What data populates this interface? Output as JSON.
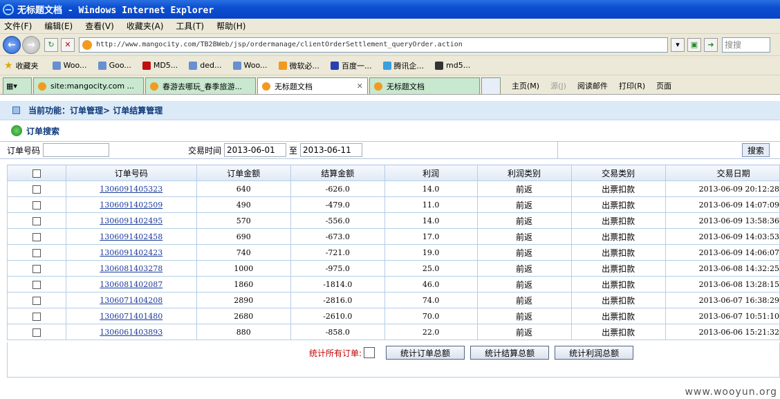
{
  "window": {
    "title": "无标题文档 - Windows Internet Explorer"
  },
  "menu": [
    "文件(F)",
    "编辑(E)",
    "查看(V)",
    "收藏夹(A)",
    "工具(T)",
    "帮助(H)"
  ],
  "address": {
    "url": "http://www.mangocity.com/TB2BWeb/jsp/ordermanage/clientOrderSettlement_queryOrder.action"
  },
  "search": {
    "placeholder": "搜搜"
  },
  "favorites": {
    "label": "收藏夹",
    "items": [
      "Woo...",
      "Goo...",
      "MD5...",
      "ded...",
      "Woo...",
      "微软必...",
      "百度一...",
      "腾讯企...",
      "md5..."
    ]
  },
  "tabs": [
    {
      "label": "site:mangocity.com ..."
    },
    {
      "label": "春游去哪玩_春季旅游..."
    },
    {
      "label": "无标题文档"
    },
    {
      "label": "无标题文档"
    }
  ],
  "tab_tools": [
    "主页(M)",
    "源(J)",
    "阅读邮件",
    "打印(R)",
    "页面"
  ],
  "page": {
    "breadcrumb": "当前功能：订单管理> 订单结算管理",
    "section_title": "订单搜索",
    "search": {
      "order_no_label": "订单号码",
      "order_no_value": "",
      "date_label": "交易时间",
      "date_from": "2013-06-01",
      "date_sep": "至",
      "date_to": "2013-06-11",
      "button": "搜索"
    },
    "table": {
      "headers": [
        "订单号码",
        "订单金额",
        "结算金额",
        "利润",
        "利润类别",
        "交易类别",
        "交易日期"
      ],
      "rows": [
        [
          "1306091405323",
          "640",
          "-626.0",
          "14.0",
          "前返",
          "出票扣款",
          "2013-06-09 20:12:28"
        ],
        [
          "1306091402509",
          "490",
          "-479.0",
          "11.0",
          "前返",
          "出票扣款",
          "2013-06-09 14:07:09"
        ],
        [
          "1306091402495",
          "570",
          "-556.0",
          "14.0",
          "前返",
          "出票扣款",
          "2013-06-09 13:58:36"
        ],
        [
          "1306091402458",
          "690",
          "-673.0",
          "17.0",
          "前返",
          "出票扣款",
          "2013-06-09 14:03:53"
        ],
        [
          "1306091402423",
          "740",
          "-721.0",
          "19.0",
          "前返",
          "出票扣款",
          "2013-06-09 14:06:07"
        ],
        [
          "1306081403278",
          "1000",
          "-975.0",
          "25.0",
          "前返",
          "出票扣款",
          "2013-06-08 14:32:25"
        ],
        [
          "1306081402087",
          "1860",
          "-1814.0",
          "46.0",
          "前返",
          "出票扣款",
          "2013-06-08 13:28:15"
        ],
        [
          "1306071404208",
          "2890",
          "-2816.0",
          "74.0",
          "前返",
          "出票扣款",
          "2013-06-07 16:38:29"
        ],
        [
          "1306071401480",
          "2680",
          "-2610.0",
          "70.0",
          "前返",
          "出票扣款",
          "2013-06-07 10:51:10"
        ],
        [
          "1306061403893",
          "880",
          "-858.0",
          "22.0",
          "前返",
          "出票扣款",
          "2013-06-06 15:21:32"
        ]
      ]
    },
    "footer": {
      "all_orders_label": "统计所有订单:",
      "buttons": [
        "统计订单总额",
        "统计结算总额",
        "统计利润总额"
      ]
    }
  },
  "watermark": "www.wooyun.org"
}
